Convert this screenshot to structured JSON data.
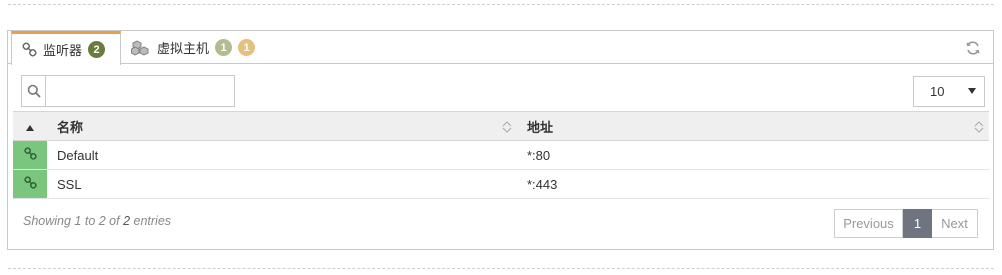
{
  "tabs": [
    {
      "label": "监听器",
      "badges": [
        "2"
      ],
      "icon": "link-icon",
      "active": true
    },
    {
      "label": "虚拟主机",
      "badges": [
        "1",
        "1"
      ],
      "icon": "cubes-icon",
      "active": false
    }
  ],
  "search": {
    "value": "",
    "placeholder": ""
  },
  "page_size": {
    "selected": "10"
  },
  "table": {
    "columns": [
      "名称",
      "地址"
    ],
    "rows": [
      {
        "icon": "link-icon",
        "name": "Default",
        "address": "*:80"
      },
      {
        "icon": "link-icon",
        "name": "SSL",
        "address": "*:443"
      }
    ]
  },
  "footer": {
    "info_prefix": "Showing 1 to 2 of ",
    "info_total": "2",
    "info_suffix": " entries"
  },
  "pagination": {
    "previous": "Previous",
    "current": "1",
    "next": "Next"
  },
  "colors": {
    "active_tab_accent": "#e9a04a",
    "badge_green": "#6a7b3f",
    "badge_olive": "#b4bb8e",
    "badge_tan": "#e3c27f",
    "row_icon_bg": "#7bc67e",
    "current_page_bg": "#6f7580"
  }
}
